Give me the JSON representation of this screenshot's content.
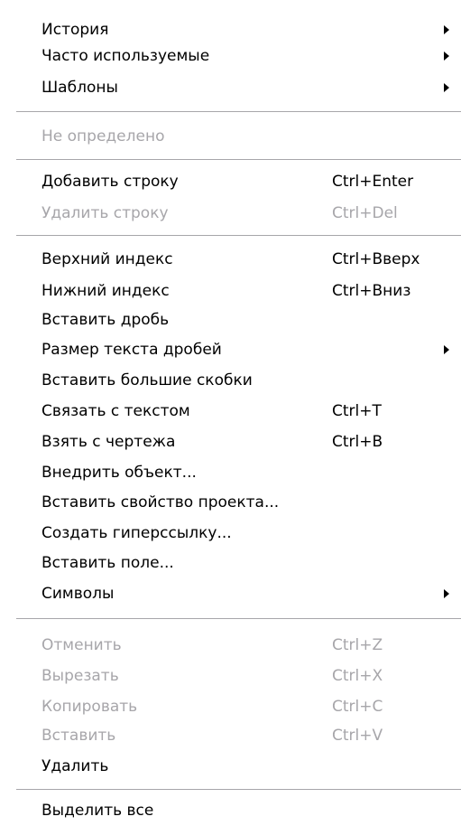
{
  "menu": {
    "history": {
      "label": "История"
    },
    "frequent": {
      "label": "Часто используемые"
    },
    "templates": {
      "label": "Шаблоны"
    },
    "undefined": {
      "label": "Не определено"
    },
    "add_row": {
      "label": "Добавить строку",
      "shortcut": "Ctrl+Enter"
    },
    "delete_row": {
      "label": "Удалить строку",
      "shortcut": "Ctrl+Del"
    },
    "superscript": {
      "label": "Верхний индекс",
      "shortcut": "Ctrl+Вверх"
    },
    "subscript": {
      "label": "Нижний индекс",
      "shortcut": "Ctrl+Вниз"
    },
    "insert_fraction": {
      "label": "Вставить дробь"
    },
    "fraction_text_size": {
      "label": "Размер текста дробей"
    },
    "insert_big_brackets": {
      "label": "Вставить большие скобки"
    },
    "link_with_text": {
      "label": "Связать с текстом",
      "shortcut": "Ctrl+T"
    },
    "take_from_drawing": {
      "label": "Взять с чертежа",
      "shortcut": "Ctrl+B"
    },
    "embed_object": {
      "label": "Внедрить объект..."
    },
    "insert_project_property": {
      "label": "Вставить свойство проекта..."
    },
    "create_hyperlink": {
      "label": "Создать гиперссылку..."
    },
    "insert_field": {
      "label": "Вставить поле..."
    },
    "symbols": {
      "label": "Символы"
    },
    "undo": {
      "label": "Отменить",
      "shortcut": "Ctrl+Z"
    },
    "cut": {
      "label": "Вырезать",
      "shortcut": "Ctrl+X"
    },
    "copy": {
      "label": "Копировать",
      "shortcut": "Ctrl+C"
    },
    "paste": {
      "label": "Вставить",
      "shortcut": "Ctrl+V"
    },
    "delete": {
      "label": "Удалить"
    },
    "select_all": {
      "label": "Выделить все"
    }
  },
  "colors": {
    "enabled_text": "#000000",
    "disabled_text": "#a7a6aa",
    "separator": "#a7a6aa",
    "background": "#ffffff"
  }
}
